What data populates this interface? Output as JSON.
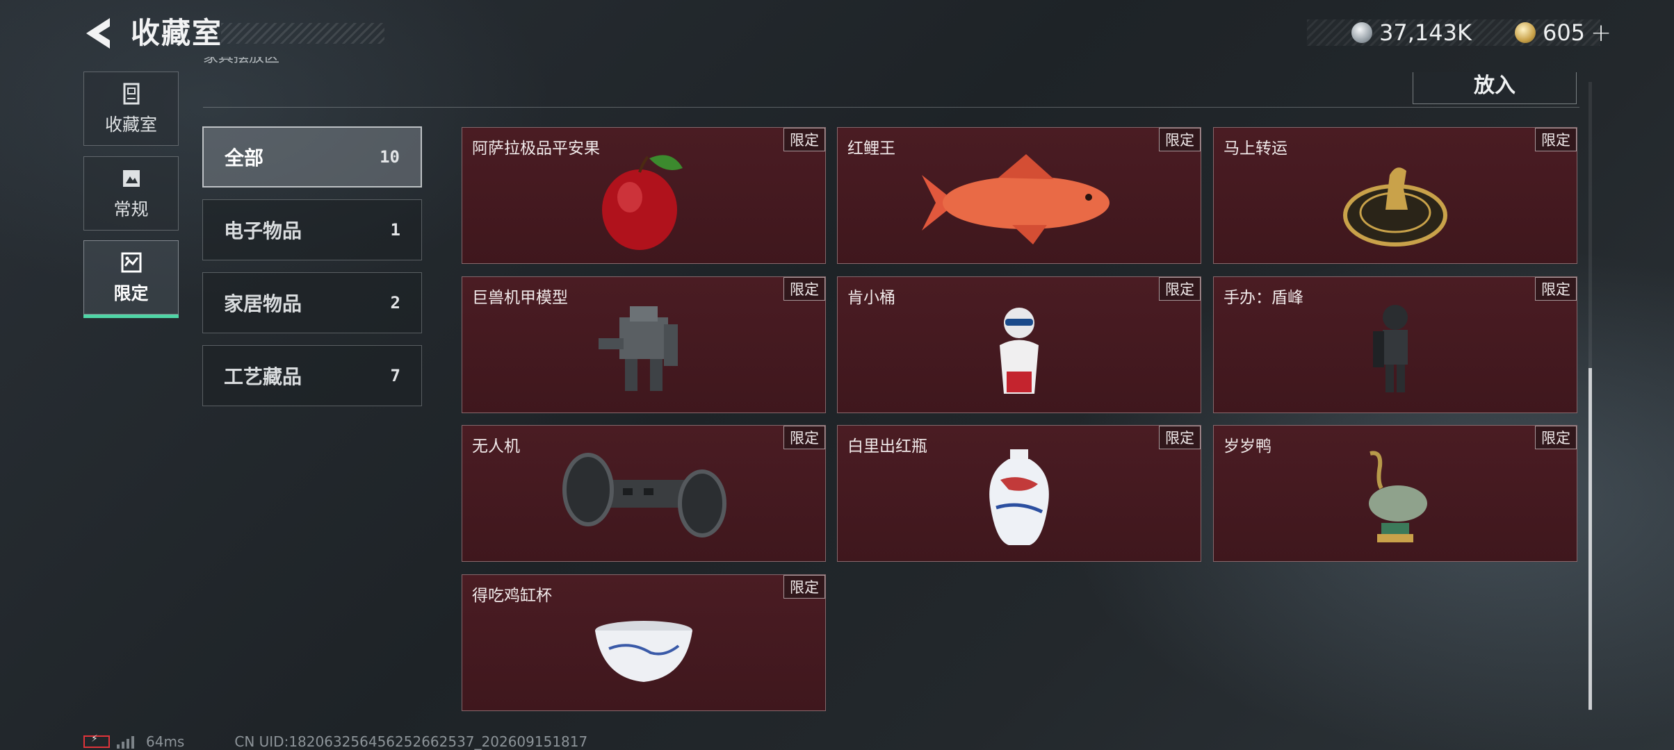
{
  "header": {
    "title": "收藏室",
    "currencies": [
      {
        "icon": "silver-coin-icon",
        "value": "37,143K"
      },
      {
        "icon": "gold-coin-icon",
        "value": "605"
      }
    ],
    "plus_label": "+"
  },
  "nav": {
    "tabs": [
      {
        "label": "收藏室",
        "icon": "collection-room-icon",
        "active": false
      },
      {
        "label": "常规",
        "icon": "regular-icon",
        "active": false
      },
      {
        "label": "限定",
        "icon": "limited-icon",
        "active": true
      }
    ]
  },
  "section": {
    "label": "家具摆放区",
    "place_button": "放入"
  },
  "categories": [
    {
      "name": "全部",
      "count": "10",
      "active": true
    },
    {
      "name": "电子物品",
      "count": "1",
      "active": false
    },
    {
      "name": "家居物品",
      "count": "2",
      "active": false
    },
    {
      "name": "工艺藏品",
      "count": "7",
      "active": false
    }
  ],
  "items": [
    {
      "name": "阿萨拉极品平安果",
      "tag": "限定",
      "icon": "apple-icon"
    },
    {
      "name": "红鲤王",
      "tag": "限定",
      "icon": "carp-fish-icon"
    },
    {
      "name": "马上转运",
      "tag": "限定",
      "icon": "horse-wheel-icon"
    },
    {
      "name": "巨兽机甲模型",
      "tag": "限定",
      "icon": "mech-model-icon"
    },
    {
      "name": "肯小桶",
      "tag": "限定",
      "icon": "bucket-figure-icon"
    },
    {
      "name": "手办：盾峰",
      "tag": "限定",
      "icon": "soldier-figure-icon"
    },
    {
      "name": "无人机",
      "tag": "限定",
      "icon": "drone-icon"
    },
    {
      "name": "白里出红瓶",
      "tag": "限定",
      "icon": "porcelain-vase-icon"
    },
    {
      "name": "岁岁鸭",
      "tag": "限定",
      "icon": "duck-statue-icon"
    },
    {
      "name": "得吃鸡缸杯",
      "tag": "限定",
      "icon": "porcelain-cup-icon"
    }
  ],
  "status": {
    "ping": "64ms",
    "uid": "CN UID:1820632564562526625​37_202609151817"
  },
  "colors": {
    "accent": "#4fd6a6",
    "card_bg": "#4a1c23",
    "battery_low": "#e0343a"
  }
}
